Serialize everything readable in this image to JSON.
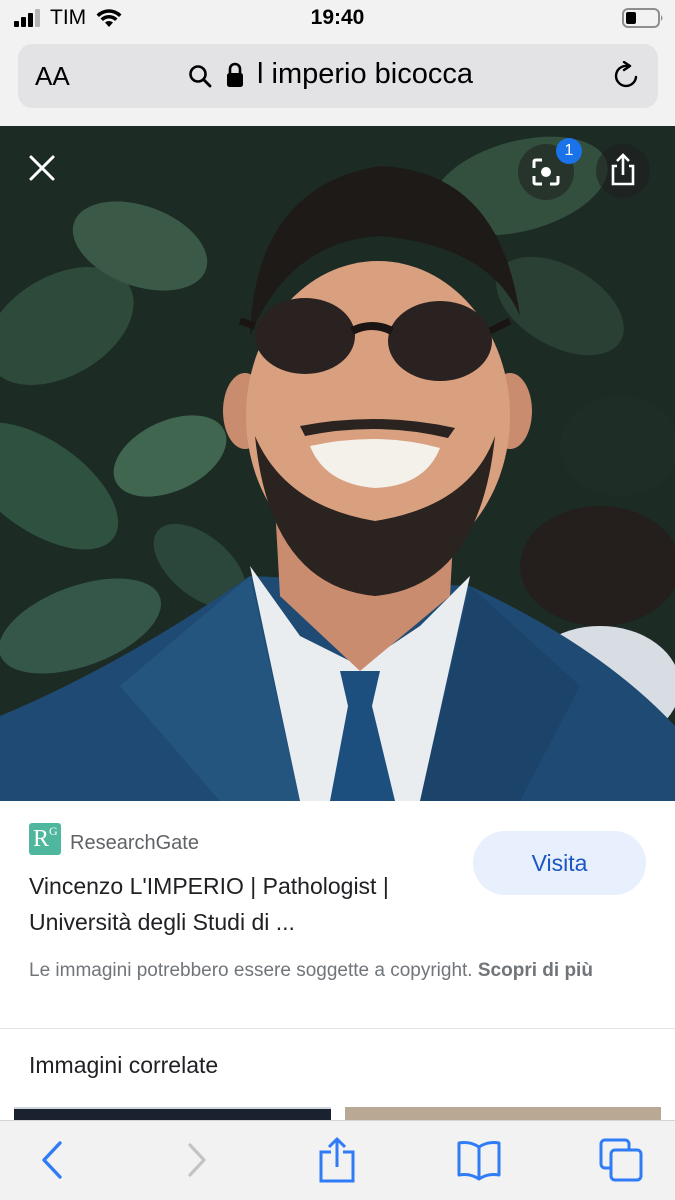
{
  "status_bar": {
    "carrier": "TIM",
    "time": "19:40"
  },
  "url_bar": {
    "text_size_label": "AA",
    "url_text": "l imperio bicocca"
  },
  "photo": {
    "lens_badge_count": "1"
  },
  "result": {
    "source_name": "ResearchGate",
    "source_logo_text": "R",
    "source_logo_superscript": "G",
    "title": "Vincenzo L'IMPERIO | Pathologist | Università degli Studi di ...",
    "visit_label": "Visita",
    "copyright_text": "Le immagini potrebbero essere soggette a copyright.",
    "learn_more_label": "Scopri di più"
  },
  "related": {
    "heading": "Immagini correlate"
  },
  "colors": {
    "accent_blue": "#1a73e8",
    "visit_bg": "#e8effd",
    "researchgate_green": "#4fb79d",
    "ios_blue": "#2f7cf6"
  },
  "icons": [
    "signal-icon",
    "wifi-icon",
    "battery-icon",
    "search-icon",
    "lock-icon",
    "reload-icon",
    "close-icon",
    "lens-icon",
    "share-icon",
    "back-icon",
    "forward-icon",
    "bookmarks-icon",
    "tabs-icon"
  ]
}
